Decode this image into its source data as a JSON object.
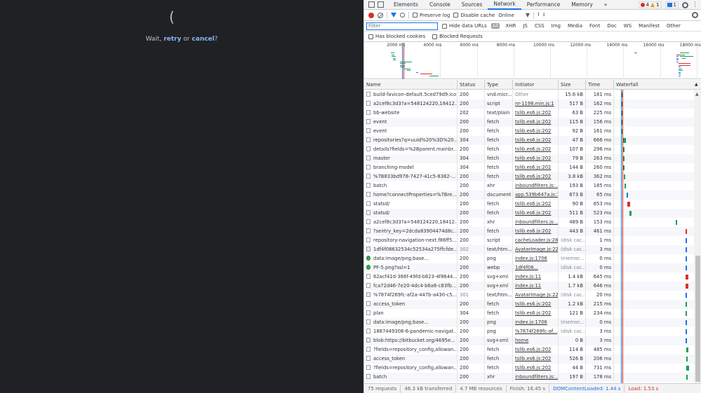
{
  "page": {
    "spinner_glyph": "(",
    "wait_prefix": "Wait, ",
    "retry_label": "retry",
    "or_text": " or ",
    "cancel_label": "cancel",
    "wait_suffix": "?"
  },
  "devtools": {
    "tabs": [
      "Elements",
      "Console",
      "Sources",
      "Network",
      "Performance",
      "Memory"
    ],
    "more_tabs": "»",
    "active_tab": "Network",
    "errors": "4",
    "warnings": "1",
    "messages": "1",
    "kebab": "⋮"
  },
  "toolbar": {
    "preserve_log": "Preserve log",
    "disable_cache": "Disable cache",
    "throttle": "Online",
    "throttle_arrow": "▼",
    "upload_arrow": "⭱",
    "download_arrow": "⭳"
  },
  "filterbar": {
    "placeholder": "Filter",
    "hide_data_urls": "Hide data URLs",
    "types": [
      "All",
      "XHR",
      "JS",
      "CSS",
      "Img",
      "Media",
      "Font",
      "Doc",
      "WS",
      "Manifest",
      "Other"
    ],
    "selected_type": "All"
  },
  "blockbar": {
    "has_blocked_cookies": "Has blocked cookies",
    "blocked_requests": "Blocked Requests"
  },
  "overview": {
    "ticks": [
      "2000 ms",
      "4000 ms",
      "6000 ms",
      "8000 ms",
      "10000 ms",
      "12000 ms",
      "14000 ms",
      "16000 ms",
      "18000 ms"
    ]
  },
  "columns": {
    "name": "Name",
    "status": "Status",
    "type": "Type",
    "initiator": "Initiator",
    "size": "Size",
    "time": "Time",
    "waterfall": "Waterfall",
    "sort_arrow": "▲"
  },
  "requests": [
    {
      "icon": "file",
      "name": "build-favicon-default.5ced79d9.ico",
      "status": "200",
      "type": "vnd.micr...",
      "initiator": "Other",
      "initiator_link": false,
      "size": "15.6 kB",
      "time": "181 ms",
      "wf_start": 1.3,
      "wf_color": "#1a9e5c"
    },
    {
      "icon": "file",
      "name": "a2cef8c3d3?a=548124220,18412...",
      "status": "200",
      "type": "script",
      "initiator": "nr-1198.min.js:1",
      "initiator_link": true,
      "size": "517 B",
      "time": "162 ms",
      "wf_start": 1.35,
      "wf_color": "#1a9e5c"
    },
    {
      "icon": "file",
      "name": "bb-website",
      "status": "202",
      "type": "text/plain",
      "initiator": "tslib.es6.js:202",
      "initiator_link": true,
      "size": "63 B",
      "time": "225 ms",
      "wf_start": 1.35,
      "wf_color": "#1a9e5c"
    },
    {
      "icon": "file",
      "name": "event",
      "status": "200",
      "type": "fetch",
      "initiator": "tslib.es6.js:202",
      "initiator_link": true,
      "size": "115 B",
      "time": "156 ms",
      "wf_start": 1.4,
      "wf_color": "#1a9e5c"
    },
    {
      "icon": "file",
      "name": "event",
      "status": "200",
      "type": "fetch",
      "initiator": "tslib.es6.js:202",
      "initiator_link": true,
      "size": "92 B",
      "time": "161 ms",
      "wf_start": 1.4,
      "wf_color": "#1a9e5c"
    },
    {
      "icon": "file",
      "name": "repositories?q=uuid%20%3D%20...",
      "status": "304",
      "type": "fetch",
      "initiator": "tslib.es6.js:202",
      "initiator_link": true,
      "size": "47 B",
      "time": "666 ms",
      "wf_start": 1.8,
      "wf_color": "#1a9e5c"
    },
    {
      "icon": "file",
      "name": "details?fields=%2Bparent.mainbr...",
      "status": "200",
      "type": "fetch",
      "initiator": "tslib.es6.js:202",
      "initiator_link": true,
      "size": "107 B",
      "time": "296 ms",
      "wf_start": 1.8,
      "wf_color": "#1a9e5c"
    },
    {
      "icon": "file",
      "name": "master",
      "status": "304",
      "type": "fetch",
      "initiator": "tslib.es6.js:202",
      "initiator_link": true,
      "size": "79 B",
      "time": "263 ms",
      "wf_start": 1.8,
      "wf_color": "#1a9e5c"
    },
    {
      "icon": "file",
      "name": "branching-model",
      "status": "304",
      "type": "fetch",
      "initiator": "tslib.es6.js:202",
      "initiator_link": true,
      "size": "144 B",
      "time": "260 ms",
      "wf_start": 1.8,
      "wf_color": "#1a9e5c"
    },
    {
      "icon": "file",
      "name": "%7B833bd978-7427-41c5-8382-...",
      "status": "200",
      "type": "fetch",
      "initiator": "tslib.es6.js:202",
      "initiator_link": true,
      "size": "3.8 kB",
      "time": "362 ms",
      "wf_start": 2.0,
      "wf_color": "#1a9e5c"
    },
    {
      "icon": "file",
      "name": "batch",
      "status": "200",
      "type": "xhr",
      "initiator": "inboundfilters.js:...",
      "initiator_link": true,
      "size": "193 B",
      "time": "185 ms",
      "wf_start": 2.2,
      "wf_color": "#1a9e5c"
    },
    {
      "icon": "file",
      "name": "home?connectProperties=%7Bre...",
      "status": "200",
      "type": "document",
      "initiator": "app.539b647a.js:1",
      "initiator_link": true,
      "size": "873 B",
      "time": "65 ms",
      "wf_start": 2.7,
      "wf_color": "#1a73e8"
    },
    {
      "icon": "file",
      "name": "statsd/",
      "status": "200",
      "type": "fetch",
      "initiator": "tslib.es6.js:202",
      "initiator_link": true,
      "size": "90 B",
      "time": "653 ms",
      "wf_start": 2.9,
      "wf_color": "#d93025"
    },
    {
      "icon": "file",
      "name": "statsd/",
      "status": "200",
      "type": "fetch",
      "initiator": "tslib.es6.js:202",
      "initiator_link": true,
      "size": "511 B",
      "time": "523 ms",
      "wf_start": 3.4,
      "wf_color": "#1a9e5c"
    },
    {
      "icon": "file",
      "name": "a2cef8c3d3?a=548124220,18412...",
      "status": "200",
      "type": "xhr",
      "initiator": "inboundfilters.js:...",
      "initiator_link": true,
      "size": "489 B",
      "time": "153 ms",
      "wf_start": 14.6,
      "wf_color": "#1a9e5c"
    },
    {
      "icon": "file",
      "name": "?sentry_key=2dcda83904474d8c...",
      "status": "200",
      "type": "fetch",
      "initiator": "tslib.es6.js:202",
      "initiator_link": true,
      "size": "443 B",
      "time": "461 ms",
      "wf_start": 16.9,
      "wf_color": "#d93025"
    },
    {
      "icon": "file",
      "name": "repository-navigation-next.f86ff5...",
      "status": "200",
      "type": "script",
      "initiator": "cacheLoader.js:28",
      "initiator_link": true,
      "size": "(disk cac...",
      "time": "1 ms",
      "wf_start": 16.9,
      "wf_color": "#1a73e8"
    },
    {
      "icon": "doc",
      "name": "1df4f08632534c52534a275ffcfde...",
      "status": "302",
      "type": "text/htm...",
      "initiator": "AvatarImage.js:22",
      "initiator_link": true,
      "size": "(disk cac...",
      "time": "3 ms",
      "wf_start": 16.9,
      "wf_color": "#1a73e8"
    },
    {
      "icon": "img",
      "name": "data:image/png;base...",
      "status": "200",
      "type": "png",
      "initiator": "index.js:1706",
      "initiator_link": true,
      "size": "(memor...",
      "time": "0 ms",
      "wf_start": 16.9,
      "wf_color": "#1a73e8"
    },
    {
      "icon": "img",
      "name": "PF-5.png?ssl=1",
      "status": "200",
      "type": "webp",
      "initiator": "1df4f08...",
      "initiator_link": true,
      "size": "(disk cac...",
      "time": "0 ms",
      "wf_start": 16.9,
      "wf_color": "#1a73e8"
    },
    {
      "icon": "file",
      "name": "62acf41d-386f-49fd-b823-4f8644...",
      "status": "200",
      "type": "svg+xml",
      "initiator": "index.js:11",
      "initiator_link": true,
      "size": "1.4 kB",
      "time": "645 ms",
      "wf_start": 17.0,
      "wf_color": "#d93025"
    },
    {
      "icon": "file",
      "name": "fca72d46-7e20-4dc4-b6a8-c83fb...",
      "status": "200",
      "type": "svg+xml",
      "initiator": "index.js:11",
      "initiator_link": true,
      "size": "1.7 kB",
      "time": "646 ms",
      "wf_start": 17.0,
      "wf_color": "#d93025"
    },
    {
      "icon": "doc",
      "name": "%7874f269fc-af2a-447b-a430-c5...",
      "status": "301",
      "type": "text/htm...",
      "initiator": "AvatarImage.js:22",
      "initiator_link": true,
      "size": "(disk cac...",
      "time": "20 ms",
      "wf_start": 17.0,
      "wf_color": "#1a73e8"
    },
    {
      "icon": "file",
      "name": "access_token",
      "status": "200",
      "type": "fetch",
      "initiator": "tslib.es6.js:202",
      "initiator_link": true,
      "size": "1.2 kB",
      "time": "215 ms",
      "wf_start": 17.0,
      "wf_color": "#1a9e5c"
    },
    {
      "icon": "file",
      "name": "plan",
      "status": "304",
      "type": "fetch",
      "initiator": "tslib.es6.js:202",
      "initiator_link": true,
      "size": "121 B",
      "time": "234 ms",
      "wf_start": 17.0,
      "wf_color": "#1a9e5c"
    },
    {
      "icon": "file",
      "name": "data:image/png;base...",
      "status": "200",
      "type": "png",
      "initiator": "index.js:1706",
      "initiator_link": true,
      "size": "(memor...",
      "time": "0 ms",
      "wf_start": 17.0,
      "wf_color": "#1a73e8"
    },
    {
      "icon": "file",
      "name": "1887449308-6-pandemic-navigat...",
      "status": "200",
      "type": "png",
      "initiator": "%7874f269fc-af...",
      "initiator_link": true,
      "size": "(disk cac...",
      "time": "3 ms",
      "wf_start": 17.0,
      "wf_color": "#1a73e8"
    },
    {
      "icon": "doc",
      "name": "blob:https://bitbucket.org/4695e...",
      "status": "200",
      "type": "svg+xml",
      "initiator": "home",
      "initiator_link": true,
      "size": "0 B",
      "time": "3 ms",
      "wf_start": 17.0,
      "wf_color": "#1a73e8"
    },
    {
      "icon": "file",
      "name": "?fields=repository_config,allowan...",
      "status": "200",
      "type": "fetch",
      "initiator": "tslib.es6.js:202",
      "initiator_link": true,
      "size": "114 B",
      "time": "485 ms",
      "wf_start": 17.1,
      "wf_color": "#1a9e5c"
    },
    {
      "icon": "file",
      "name": "access_token",
      "status": "200",
      "type": "fetch",
      "initiator": "tslib.es6.js:202",
      "initiator_link": true,
      "size": "526 B",
      "time": "206 ms",
      "wf_start": 17.1,
      "wf_color": "#1a9e5c"
    },
    {
      "icon": "file",
      "name": "?fields=repository_config,allowan...",
      "status": "200",
      "type": "fetch",
      "initiator": "tslib.es6.js:202",
      "initiator_link": true,
      "size": "44 B",
      "time": "731 ms",
      "wf_start": 17.1,
      "wf_color": "#1a9e5c"
    },
    {
      "icon": "file",
      "name": "batch",
      "status": "200",
      "type": "xhr",
      "initiator": "inboundfilters.js:...",
      "initiator_link": true,
      "size": "197 B",
      "time": "178 ms",
      "wf_start": 17.2,
      "wf_color": "#1a9e5c"
    }
  ],
  "status": {
    "requests": "75 requests",
    "transferred": "46.3 kB transferred",
    "resources": "4.7 MB resources",
    "finish": "Finish: 16.45 s",
    "dom_content_loaded": "DOMContentLoaded: 1.44 s",
    "load": "Load: 1.53 s"
  },
  "colors": {
    "record": "#d93025",
    "accent": "#1a73e8",
    "waterfall_green": "#1a9e5c",
    "dcl_line": "#1a73e8",
    "load_line": "#d93025"
  }
}
